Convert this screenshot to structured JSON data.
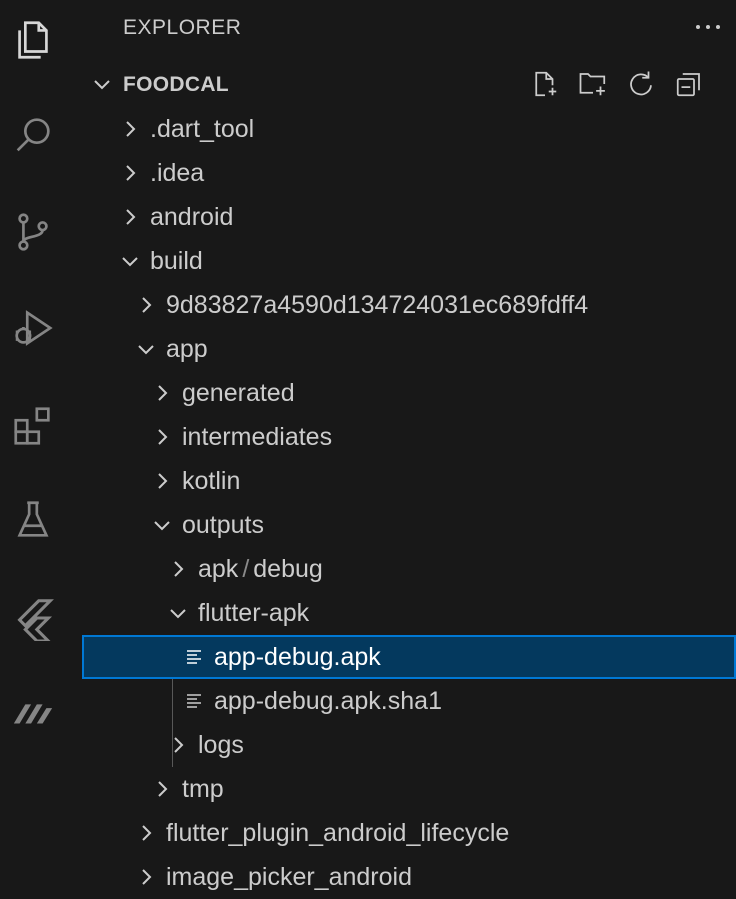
{
  "activity_bar": {
    "items": [
      {
        "name": "explorer-icon"
      },
      {
        "name": "search-icon"
      },
      {
        "name": "source-control-icon"
      },
      {
        "name": "run-debug-icon"
      },
      {
        "name": "extensions-icon"
      },
      {
        "name": "testing-icon"
      },
      {
        "name": "flutter-icon"
      },
      {
        "name": "m-extension-icon"
      }
    ]
  },
  "explorer": {
    "title": "EXPLORER",
    "more_icon": "ellipsis-icon",
    "section": {
      "title": "FOODCAL",
      "actions": [
        "new-file-icon",
        "new-folder-icon",
        "refresh-icon",
        "collapse-all-icon"
      ]
    },
    "tree": [
      {
        "label": ".dart_tool",
        "type": "folder",
        "expanded": false
      },
      {
        "label": ".idea",
        "type": "folder",
        "expanded": false
      },
      {
        "label": "android",
        "type": "folder",
        "expanded": false
      },
      {
        "label": "build",
        "type": "folder",
        "expanded": true
      },
      {
        "label": "9d83827a4590d134724031ec689fdff4",
        "type": "folder",
        "expanded": false
      },
      {
        "label": "app",
        "type": "folder",
        "expanded": true
      },
      {
        "label": "generated",
        "type": "folder",
        "expanded": false
      },
      {
        "label": "intermediates",
        "type": "folder",
        "expanded": false
      },
      {
        "label": "kotlin",
        "type": "folder",
        "expanded": false
      },
      {
        "label": "outputs",
        "type": "folder",
        "expanded": true
      },
      {
        "label_a": "apk",
        "sep": "/",
        "label_b": "debug",
        "type": "folder",
        "expanded": false
      },
      {
        "label": "flutter-apk",
        "type": "folder",
        "expanded": true
      },
      {
        "label": "app-debug.apk",
        "type": "file",
        "selected": true
      },
      {
        "label": "app-debug.apk.sha1",
        "type": "file"
      },
      {
        "label": "logs",
        "type": "folder",
        "expanded": false
      },
      {
        "label": "tmp",
        "type": "folder",
        "expanded": false
      },
      {
        "label": "flutter_plugin_android_lifecycle",
        "type": "folder",
        "expanded": false
      },
      {
        "label": "image_picker_android",
        "type": "folder",
        "expanded": false
      }
    ]
  },
  "colors": {
    "background": "#181818",
    "selection": "#04395e",
    "focus_border": "#0078d4",
    "text": "#cccccc",
    "icon": "#858585"
  }
}
